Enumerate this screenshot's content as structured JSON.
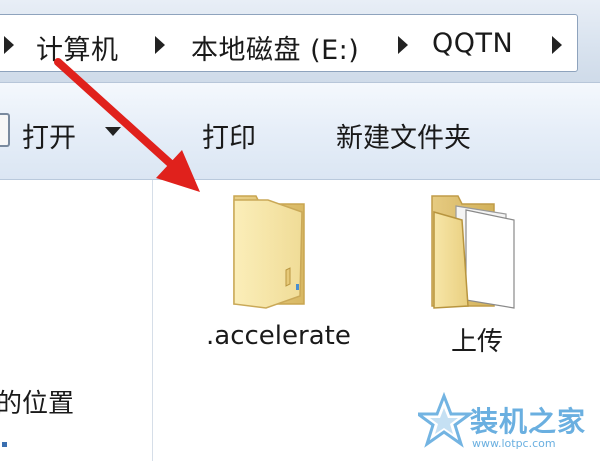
{
  "address_bar": {
    "crumbs": [
      "计算机",
      "本地磁盘 (E:)",
      "QQTN"
    ]
  },
  "toolbar": {
    "open_label": "打开",
    "print_label": "打印",
    "new_folder_label": "新建文件夹"
  },
  "nav_pane": {
    "partial_item": "的位置"
  },
  "files": [
    {
      "name": ".accelerate",
      "icon": "folder-empty-icon"
    },
    {
      "name": "上传",
      "icon": "folder-with-documents-icon"
    }
  ],
  "annotation": {
    "arrow_color": "#e0211c"
  },
  "watermark": {
    "title": "装机之家",
    "url": "www.lotpc.com"
  }
}
